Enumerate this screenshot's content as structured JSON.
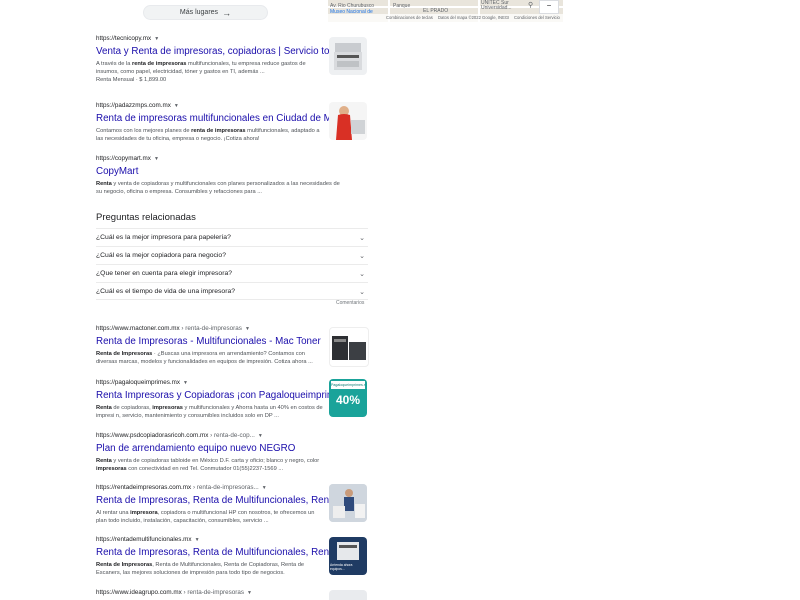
{
  "more_places": {
    "label": "Más lugares",
    "arrow": "→"
  },
  "map": {
    "labels": [
      "Av. Rio Churubusco",
      "Museo Nacional de",
      "Panque",
      "EL PRADO",
      "UNITEC Sur",
      "Universidad..."
    ],
    "controls": {
      "minus": "−"
    },
    "footer": [
      "Combinaciones de teclas",
      "Datos del mapa ©2022 Google, INEGI",
      "Condiciones del Servicio"
    ]
  },
  "results_top": [
    {
      "url": "https://tecnicopy.mx",
      "title": "Venta y Renta de impresoras, copiadoras | Servicio todo ...",
      "snippet_html": "A través de la <b>renta de impresoras</b> multifuncionales, tu empresa reduce gastos de insumos, como papel, electricidad, tóner y gastos en TI, además ...",
      "extra": "Renta Mensual · $ 1,899.00"
    },
    {
      "url": "https://padazzmps.com.mx",
      "title": "Renta de impresoras multifuncionales en Ciudad de México",
      "snippet_html": "Contamos con los mejores planes de <b>renta de impresoras</b> multifuncionales, adaptado a las necesidades de tu oficina, empresa o negocio. ¡Cotiza ahora!",
      "extra": ""
    },
    {
      "url": "https://copymart.mx",
      "title": "CopyMart",
      "snippet_html": "<b>Renta</b> y venta de copiadoras y multifuncionales con planes personalizados a las necesidades de su negocio, oficina o empresa. Consumibles y refacciones para ...",
      "extra": ""
    }
  ],
  "paa": {
    "heading": "Preguntas relacionadas",
    "questions": [
      "¿Cuál es la mejor impresora para papelería?",
      "¿Cuál es la mejor copiadora para negocio?",
      "¿Que tener en cuenta para elegir impresora?",
      "¿Cuál es el tiempo de vida de una impresora?"
    ],
    "chevron": "⌄",
    "feedback": "Comentarios"
  },
  "results_bottom": [
    {
      "url": "https://www.mactoner.com.mx",
      "crumb": "› renta-de-impresoras",
      "title": "Renta de Impresoras - Multifuncionales - Mac Toner",
      "snippet_html": "<b>Renta de Impresoras</b> · ¿Buscas una impresora en arrendamiento? Contamos con diversas marcas, modelos y funcionalidades en equipos de impresión. Cotiza ahora ..."
    },
    {
      "url": "https://pagaloqueimprimes.mx",
      "crumb": "",
      "title": "Renta Impresoras y Copiadoras ¡con Pagaloqueimprimes!",
      "snippet_html": "<b>Renta</b> de copiadoras, <b>impresoras</b> y multifuncionales y Ahorra hasta un 40% en costos de impresi n, servicio, mantenimiento y consumibles incluidos solo en DP ..."
    },
    {
      "url": "https://www.psdcopiadorasricoh.com.mx",
      "crumb": "› renta-de-cop...",
      "title": "Plan de arrendamiento equipo nuevo NEGRO",
      "snippet_html": "<b>Renta</b> y venta de copiadoras tabloide en México D.F. carta y oficio; blanco y negro, color <b>impresoras</b> con conectividad en red Tel. Conmutador 01(55)2237-1569 ..."
    },
    {
      "url": "https://rentadeimpresoras.com.mx",
      "crumb": "› renta-de-impresoras...",
      "title": "Renta de Impresoras, Renta de Multifuncionales, Renta de ...",
      "snippet_html": "Al rentar una <b>impresora</b>, copiadora o multifuncional HP con nosotros, te ofrecemos un plan todo incluido, instalación, capacitación, consumibles, servicio ..."
    },
    {
      "url": "https://rentademultifuncionales.mx",
      "crumb": "",
      "title": "Renta de Impresoras, Renta de Multifuncionales, Renta de ...",
      "snippet_html": "<b>Renta de Impresoras</b>, Renta de Multifuncionales, Renta de Copiadoras, Renta de Escaners, las mejores soluciones de impresión para todo tipo de negocios."
    },
    {
      "url": "https://www.ideagrupo.com.mx",
      "crumb": "› renta-de-impresoras",
      "title": "",
      "snippet_html": ""
    }
  ],
  "thumb_texts": {
    "pago_brand": "Pagaloqueimprimes.mx",
    "pago_badge": "40%",
    "renta_caption": "Arrienda ahora equipos..."
  },
  "colors": {
    "link": "#1a0dab",
    "snippet": "#4d5156",
    "url": "#202124",
    "divider": "#ebebeb"
  }
}
